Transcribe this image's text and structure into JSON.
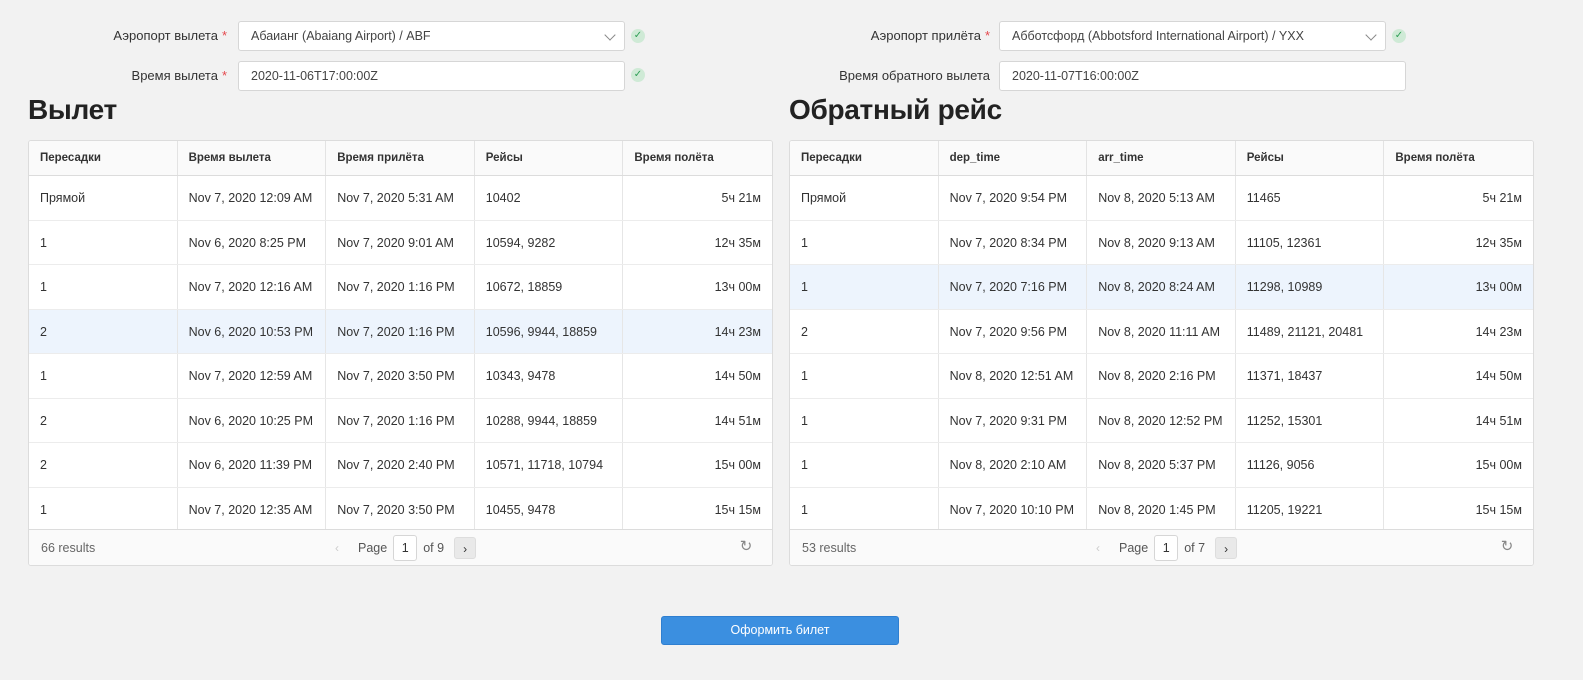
{
  "form": {
    "dep_airport_label": "Аэропорт вылета",
    "dep_airport_value": "Абаианг (Abaiang Airport) / ABF",
    "dep_time_label": "Время вылета",
    "dep_time_value": "2020-11-06T17:00:00Z",
    "arr_airport_label": "Аэропорт прилёта",
    "arr_airport_value": "Абботсфорд (Abbotsford International Airport) / YXX",
    "ret_time_label": "Время обратного вылета",
    "ret_time_value": "2020-11-07T16:00:00Z",
    "required_mark": "*",
    "ok_icon": "✓"
  },
  "outbound": {
    "title": "Вылет",
    "columns": [
      "Пересадки",
      "Время вылета",
      "Время прилёта",
      "Рейсы",
      "Время полёта"
    ],
    "rows": [
      [
        "Прямой",
        "Nov 7, 2020 12:09 AM",
        "Nov 7, 2020 5:31 AM",
        "10402",
        "5ч 21м"
      ],
      [
        "1",
        "Nov 6, 2020 8:25 PM",
        "Nov 7, 2020 9:01 AM",
        "10594, 9282",
        "12ч 35м"
      ],
      [
        "1",
        "Nov 7, 2020 12:16 AM",
        "Nov 7, 2020 1:16 PM",
        "10672, 18859",
        "13ч 00м"
      ],
      [
        "2",
        "Nov 6, 2020 10:53 PM",
        "Nov 7, 2020 1:16 PM",
        "10596, 9944, 18859",
        "14ч 23м"
      ],
      [
        "1",
        "Nov 7, 2020 12:59 AM",
        "Nov 7, 2020 3:50 PM",
        "10343, 9478",
        "14ч 50м"
      ],
      [
        "2",
        "Nov 6, 2020 10:25 PM",
        "Nov 7, 2020 1:16 PM",
        "10288, 9944, 18859",
        "14ч 51м"
      ],
      [
        "2",
        "Nov 6, 2020 11:39 PM",
        "Nov 7, 2020 2:40 PM",
        "10571, 11718, 10794",
        "15ч 00м"
      ],
      [
        "1",
        "Nov 7, 2020 12:35 AM",
        "Nov 7, 2020 3:50 PM",
        "10455, 9478",
        "15ч 15м"
      ]
    ],
    "selected_row": 3,
    "results": "66 results",
    "page_label": "Page",
    "page": "1",
    "of_pages": "of 9"
  },
  "inbound": {
    "title": "Обратный рейс",
    "columns": [
      "Пересадки",
      "dep_time",
      "arr_time",
      "Рейсы",
      "Время полёта"
    ],
    "rows": [
      [
        "Прямой",
        "Nov 7, 2020 9:54 PM",
        "Nov 8, 2020 5:13 AM",
        "11465",
        "5ч 21м"
      ],
      [
        "1",
        "Nov 7, 2020 8:34 PM",
        "Nov 8, 2020 9:13 AM",
        "11105, 12361",
        "12ч 35м"
      ],
      [
        "1",
        "Nov 7, 2020 7:16 PM",
        "Nov 8, 2020 8:24 AM",
        "11298, 10989",
        "13ч 00м"
      ],
      [
        "2",
        "Nov 7, 2020 9:56 PM",
        "Nov 8, 2020 11:11 AM",
        "11489, 21121, 20481",
        "14ч 23м"
      ],
      [
        "1",
        "Nov 8, 2020 12:51 AM",
        "Nov 8, 2020 2:16 PM",
        "11371, 18437",
        "14ч 50м"
      ],
      [
        "1",
        "Nov 7, 2020 9:31 PM",
        "Nov 8, 2020 12:52 PM",
        "11252, 15301",
        "14ч 51м"
      ],
      [
        "1",
        "Nov 8, 2020 2:10 AM",
        "Nov 8, 2020 5:37 PM",
        "11126, 9056",
        "15ч 00м"
      ],
      [
        "1",
        "Nov 7, 2020 10:10 PM",
        "Nov 8, 2020 1:45 PM",
        "11205, 19221",
        "15ч 15м"
      ]
    ],
    "selected_row": 2,
    "results": "53 results",
    "page_label": "Page",
    "page": "1",
    "of_pages": "of 7"
  },
  "pager_icons": {
    "prev": "‹",
    "next": "›",
    "refresh": "↻"
  },
  "submit_label": "Оформить билет",
  "colors": {
    "accent": "#3b8fe0",
    "selected_row": "#edf4fd",
    "valid": "#2f9e55",
    "required": "#e5484d"
  }
}
